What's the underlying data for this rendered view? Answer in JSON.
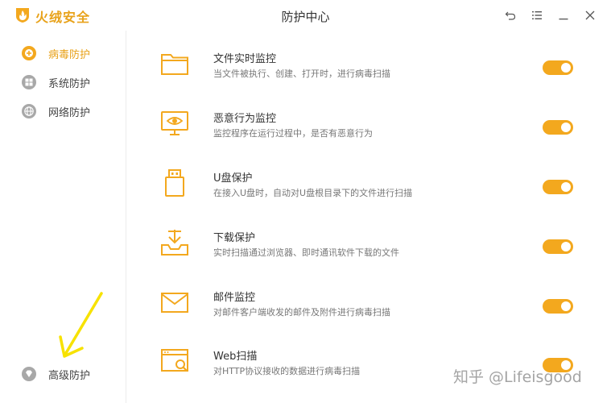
{
  "app": {
    "brand": "火绒安全",
    "window_title": "防护中心"
  },
  "colors": {
    "accent": "#f3a81e",
    "text": "#333333",
    "muted": "#777777"
  },
  "window_controls": [
    {
      "name": "back-icon"
    },
    {
      "name": "menu-icon"
    },
    {
      "name": "minimize-icon"
    },
    {
      "name": "close-icon"
    }
  ],
  "sidebar": {
    "items": [
      {
        "label": "病毒防护",
        "icon": "virus-shield-icon",
        "active": true
      },
      {
        "label": "系统防护",
        "icon": "windows-icon",
        "active": false
      },
      {
        "label": "网络防护",
        "icon": "globe-icon",
        "active": false
      }
    ],
    "bottom_item": {
      "label": "高级防护",
      "icon": "diamond-icon"
    }
  },
  "features": [
    {
      "title": "文件实时监控",
      "desc": "当文件被执行、创建、打开时，进行病毒扫描",
      "icon": "folder-icon",
      "enabled": true
    },
    {
      "title": "恶意行为监控",
      "desc": "监控程序在运行过程中，是否有恶意行为",
      "icon": "monitor-eye-icon",
      "enabled": true
    },
    {
      "title": "U盘保护",
      "desc": "在接入U盘时，自动对U盘根目录下的文件进行扫描",
      "icon": "usb-icon",
      "enabled": true
    },
    {
      "title": "下载保护",
      "desc": "实时扫描通过浏览器、即时通讯软件下载的文件",
      "icon": "download-icon",
      "enabled": true
    },
    {
      "title": "邮件监控",
      "desc": "对邮件客户端收发的邮件及附件进行病毒扫描",
      "icon": "mail-icon",
      "enabled": true
    },
    {
      "title": "Web扫描",
      "desc": "对HTTP协议接收的数据进行病毒扫描",
      "icon": "web-scan-icon",
      "enabled": true
    }
  ],
  "watermark": "知乎 @Lifeisgood"
}
